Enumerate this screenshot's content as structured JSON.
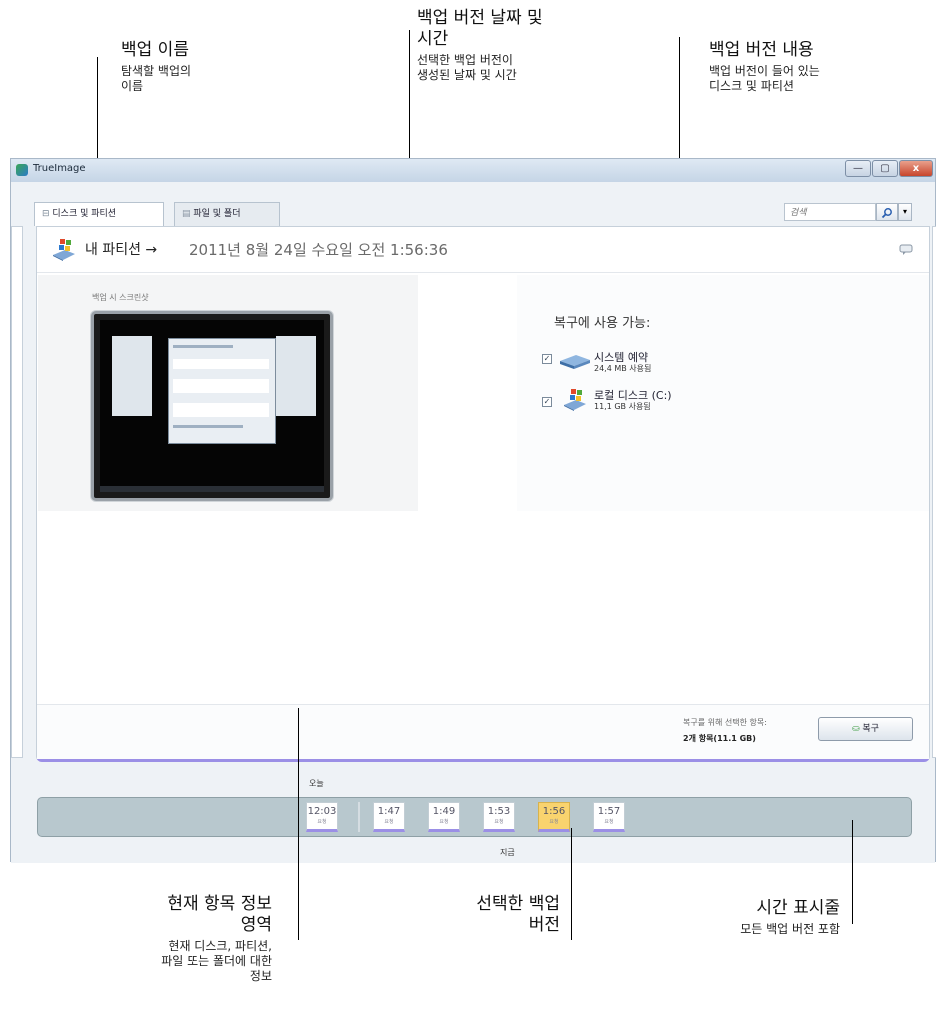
{
  "callouts": {
    "backup_name": {
      "title": "백업 이름",
      "desc_1": "탐색할 백업의",
      "desc_2": "이름"
    },
    "backup_date": {
      "title_1": "백업 버전 날짜 및",
      "title_2": "시간",
      "desc_1": "선택한 백업 버전이",
      "desc_2": "생성된 날짜 및 시간"
    },
    "backup_contents": {
      "title": "백업 버전 내용",
      "desc_1": "백업 버전이 들어 있는",
      "desc_2": "디스크 및 파티션"
    },
    "current_info": {
      "title_1": "현재 항목 정보",
      "title_2": "영역",
      "desc_1": "현재 디스크, 파티션,",
      "desc_2": "파일 또는 폴더에 대한",
      "desc_3": "정보"
    },
    "selected_version": {
      "title_1": "선택한 백업",
      "title_2": "버전"
    },
    "timeline": {
      "title": "시간 표시줄",
      "desc": "모든 백업 버전 포함"
    }
  },
  "window": {
    "title": "TrueImage",
    "controls": {
      "minimize": "—",
      "maximize": "▢",
      "close": "x"
    }
  },
  "tabs": [
    {
      "label": "디스크 및 파티션",
      "icon": "disk-icon",
      "active": true
    },
    {
      "label": "파일 및 폴더",
      "icon": "folder-icon",
      "active": false
    }
  ],
  "search": {
    "placeholder": "검색"
  },
  "partition": {
    "name": "내 파티션 →",
    "date": "2011년 8월 24일 수요일 오전 1:56:36"
  },
  "screenshot": {
    "label": "백업 시 스크린샷"
  },
  "available": {
    "title": "복구에 사용 가능:",
    "items": [
      {
        "name": "시스템 예약",
        "size": "24,4 MB 사용됨",
        "checked": true,
        "icon": "drive-icon"
      },
      {
        "name": "로컬 디스크 (C:)",
        "size": "11,1 GB 사용됨",
        "checked": true,
        "icon": "windows-drive-icon"
      }
    ]
  },
  "footer": {
    "selected_label": "복구를 위해 선택한 항목:",
    "selected_count": "2개 항목(11.1 GB)",
    "recover_button": "복구"
  },
  "timeline": {
    "today_label": "오늘",
    "now_label": "지금",
    "entries": [
      {
        "time": "12:03",
        "sub": "요청"
      },
      {
        "time": "1:47",
        "sub": "요청"
      },
      {
        "time": "1:49",
        "sub": "요청"
      },
      {
        "time": "1:53",
        "sub": "요청"
      },
      {
        "time": "1:56",
        "sub": "요청",
        "selected": true
      },
      {
        "time": "1:57",
        "sub": "요청"
      }
    ]
  },
  "colors": {
    "accent": "#9b8fe6",
    "selected": "#f9d36e",
    "timeline_bg": "#b8c8ce"
  }
}
